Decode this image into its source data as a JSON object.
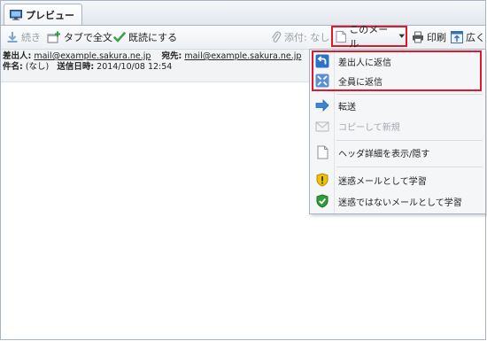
{
  "tab": {
    "label": "プレビュー",
    "icon": "monitor-icon"
  },
  "toolbar": {
    "next_label": "続き",
    "open_tab_label": "タブで全文",
    "mark_read_label": "既読にする",
    "attachment_label": "添付: なし",
    "this_mail_label": "このメール",
    "print_label": "印刷",
    "wide_label": "広く"
  },
  "header": {
    "from_label": "差出人:",
    "from_value": "mail@example.sakura.ne.jp",
    "to_label": "宛先:",
    "to_value": "mail@example.sakura.ne.jp",
    "subject_label": "件名:",
    "subject_value": "(なし)",
    "date_label": "送信日時:",
    "date_value": "2014/10/08 12:54"
  },
  "menu": {
    "reply_sender": "差出人に返信",
    "reply_all": "全員に返信",
    "forward": "転送",
    "copy_new": "コピーして新規",
    "header_details": "ヘッダ詳細を表示/隠す",
    "learn_spam": "迷惑メールとして学習",
    "learn_not_spam": "迷惑ではないメールとして学習"
  },
  "colors": {
    "highlight": "#e0182e",
    "accent": "#1a73c9",
    "spam_yellow": "#f2c200",
    "ok_green": "#2f9e3a"
  }
}
